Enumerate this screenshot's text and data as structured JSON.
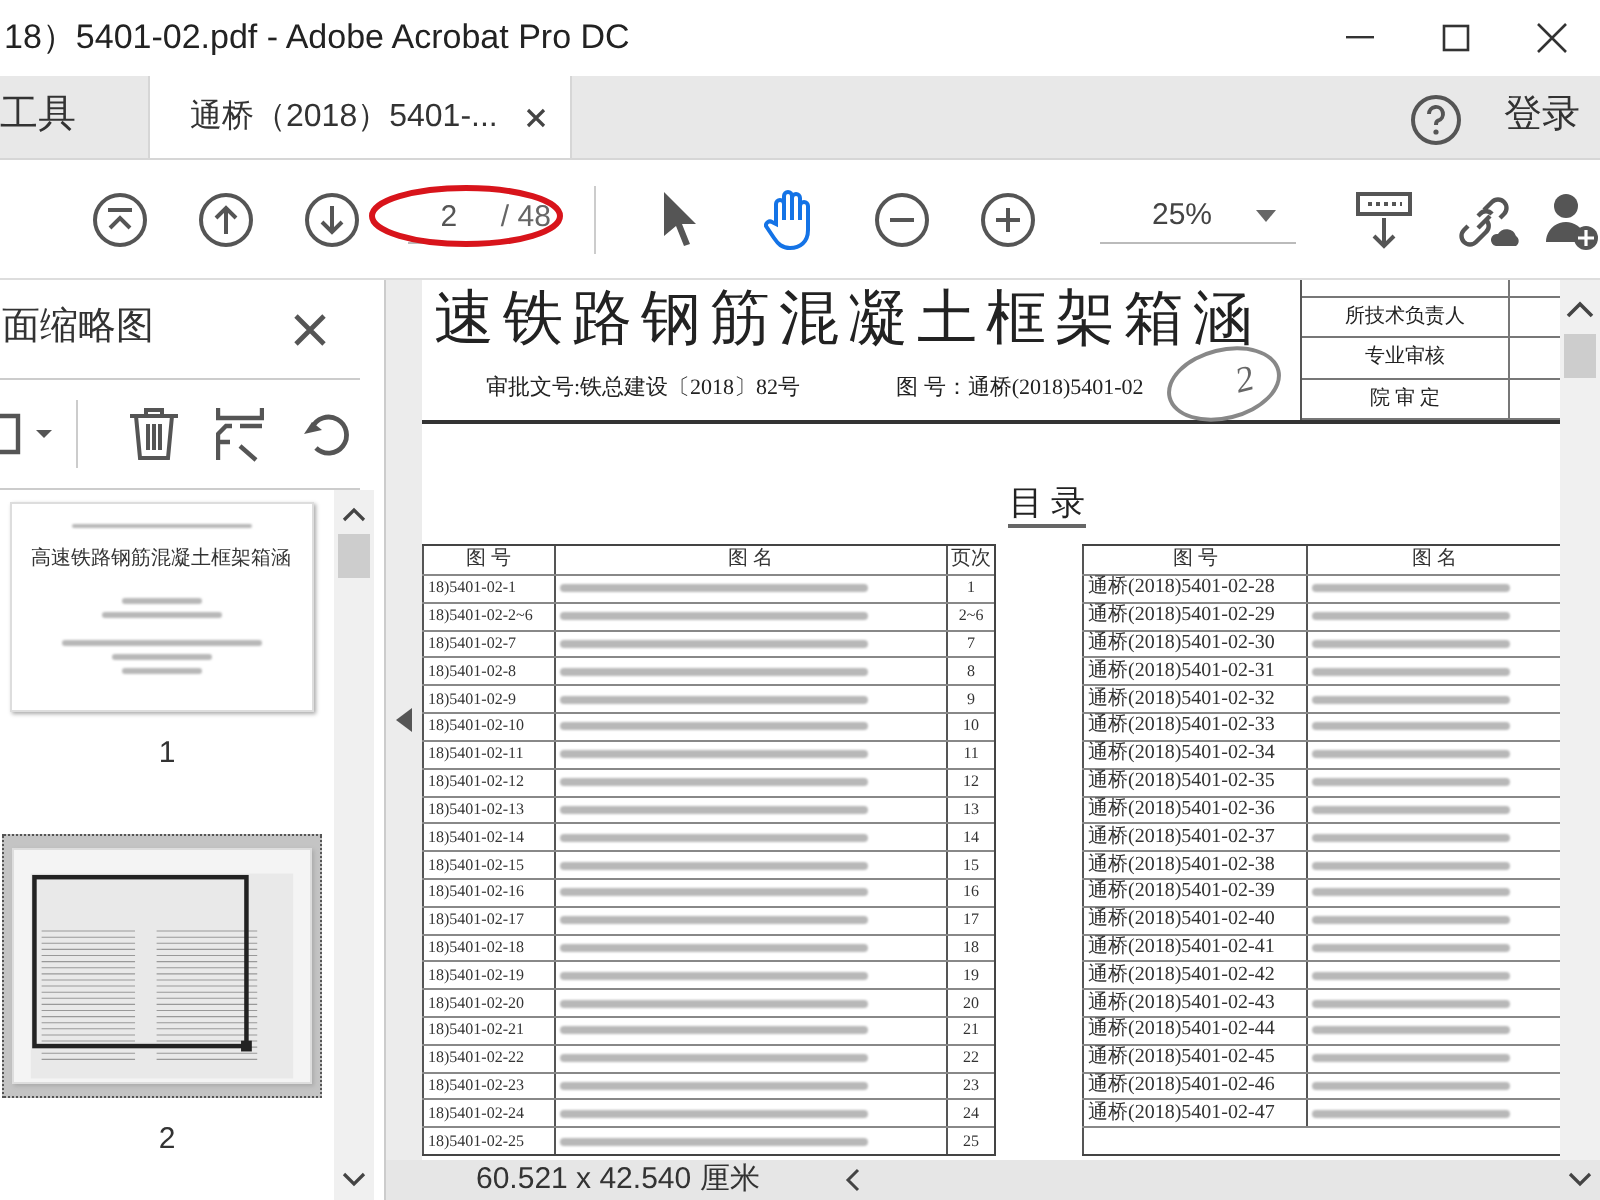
{
  "window": {
    "title": "18）5401-02.pdf - Adobe Acrobat Pro DC"
  },
  "tabs": [
    {
      "label": "工具",
      "selected": false
    },
    {
      "label": "通桥（2018）5401-...",
      "selected": true
    }
  ],
  "sign_in": "登录",
  "toolbar": {
    "page_current": "2",
    "page_total": "/ 48",
    "tools": [
      {
        "kind": "select",
        "selected": false
      },
      {
        "kind": "hand",
        "selected": true
      }
    ],
    "zoom": "25%"
  },
  "sidebar": {
    "title": "面缩略图",
    "thumbnails": [
      {
        "kind": "cover",
        "label": "1",
        "selected": false,
        "title": "高速铁路钢筋混凝土框架箱涵"
      },
      {
        "kind": "contents",
        "label": "2",
        "selected": true
      }
    ]
  },
  "document": {
    "title": "速铁路钢筋混凝土框架箱涵",
    "approval": "审批文号:铁总建设〔2018〕82号",
    "drawing_number": "图 号：通桥(2018)5401-02",
    "stamp_mark": "2",
    "signoff": [
      "所技术负责人",
      "专业审核",
      "院 审 定"
    ],
    "toc_heading": "目 录",
    "left_table": {
      "columns": [
        "图 号",
        "图 名",
        "页次"
      ],
      "rows": [
        {
          "number": "18)5401-02-1",
          "page": "1"
        },
        {
          "number": "18)5401-02-2~6",
          "page": "2~6"
        },
        {
          "number": "18)5401-02-7",
          "page": "7"
        },
        {
          "number": "18)5401-02-8",
          "page": "8"
        },
        {
          "number": "18)5401-02-9",
          "page": "9"
        },
        {
          "number": "18)5401-02-10",
          "page": "10"
        },
        {
          "number": "18)5401-02-11",
          "page": "11"
        },
        {
          "number": "18)5401-02-12",
          "page": "12"
        },
        {
          "number": "18)5401-02-13",
          "page": "13"
        },
        {
          "number": "18)5401-02-14",
          "page": "14"
        },
        {
          "number": "18)5401-02-15",
          "page": "15"
        },
        {
          "number": "18)5401-02-16",
          "page": "16"
        },
        {
          "number": "18)5401-02-17",
          "page": "17"
        },
        {
          "number": "18)5401-02-18",
          "page": "18"
        },
        {
          "number": "18)5401-02-19",
          "page": "19"
        },
        {
          "number": "18)5401-02-20",
          "page": "20"
        },
        {
          "number": "18)5401-02-21",
          "page": "21"
        },
        {
          "number": "18)5401-02-22",
          "page": "22"
        },
        {
          "number": "18)5401-02-23",
          "page": "23"
        },
        {
          "number": "18)5401-02-24",
          "page": "24"
        },
        {
          "number": "18)5401-02-25",
          "page": "25"
        }
      ]
    },
    "right_table": {
      "columns": [
        "图 号",
        "图 名"
      ],
      "rows": [
        {
          "number": "通桥(2018)5401-02-28"
        },
        {
          "number": "通桥(2018)5401-02-29"
        },
        {
          "number": "通桥(2018)5401-02-30"
        },
        {
          "number": "通桥(2018)5401-02-31"
        },
        {
          "number": "通桥(2018)5401-02-32"
        },
        {
          "number": "通桥(2018)5401-02-33"
        },
        {
          "number": "通桥(2018)5401-02-34"
        },
        {
          "number": "通桥(2018)5401-02-35"
        },
        {
          "number": "通桥(2018)5401-02-36"
        },
        {
          "number": "通桥(2018)5401-02-37"
        },
        {
          "number": "通桥(2018)5401-02-38"
        },
        {
          "number": "通桥(2018)5401-02-39"
        },
        {
          "number": "通桥(2018)5401-02-40"
        },
        {
          "number": "通桥(2018)5401-02-41"
        },
        {
          "number": "通桥(2018)5401-02-42"
        },
        {
          "number": "通桥(2018)5401-02-43"
        },
        {
          "number": "通桥(2018)5401-02-44"
        },
        {
          "number": "通桥(2018)5401-02-45"
        },
        {
          "number": "通桥(2018)5401-02-46"
        },
        {
          "number": "通桥(2018)5401-02-47"
        }
      ]
    }
  },
  "status_bar": {
    "page_size": "60.521 x 42.540 厘米"
  }
}
